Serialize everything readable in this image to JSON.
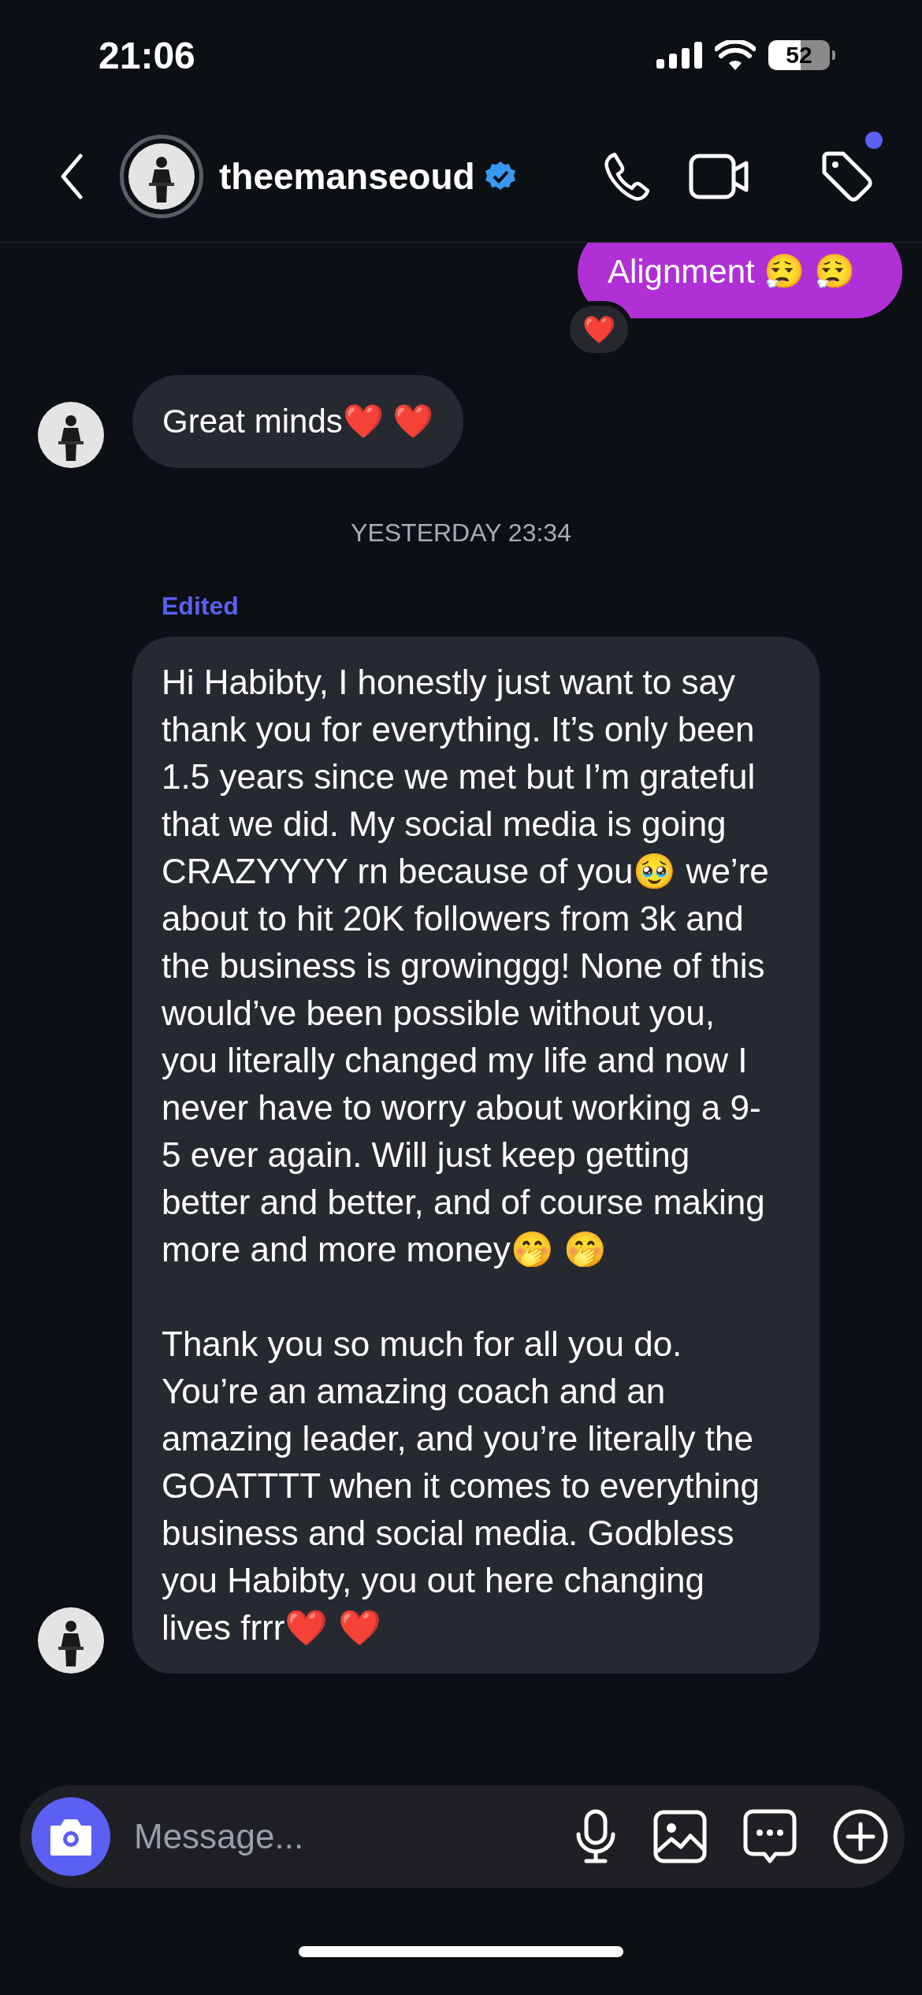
{
  "status_bar": {
    "time": "21:06",
    "battery": "52"
  },
  "header": {
    "username": "theemanseoud",
    "verified": true,
    "notification_dot": true
  },
  "messages": [
    {
      "kind": "sent",
      "text": "Alignment 😮‍💨 😮‍💨",
      "reaction": "❤️"
    },
    {
      "kind": "received",
      "text": "Great minds❤️ ❤️",
      "avatar": true
    },
    {
      "kind": "timestamp",
      "text": "YESTERDAY 23:34"
    },
    {
      "kind": "received",
      "label": "Edited",
      "paragraphs": [
        "Hi Habibty, I honestly just want to say thank you for everything. It’s only been 1.5 years since we met but I’m grateful that we did. My social media is going CRAZYYYY rn because of you🥹  we’re about to hit 20K followers from 3k and the business is growinggg! None of this would’ve been possible without you, you literally changed my life and now I never have to worry about working a 9-5 ever again. Will just keep getting better and better, and of course making more and more money🤭 🤭",
        "Thank you so much for all you do. You’re an amazing coach and an amazing leader, and you’re literally the GOATTTT when it comes to everything business and social media. Godbless you Habibty, you out here changing lives frrr❤️ ❤️"
      ],
      "avatar": true
    }
  ],
  "composer": {
    "placeholder": "Message..."
  }
}
